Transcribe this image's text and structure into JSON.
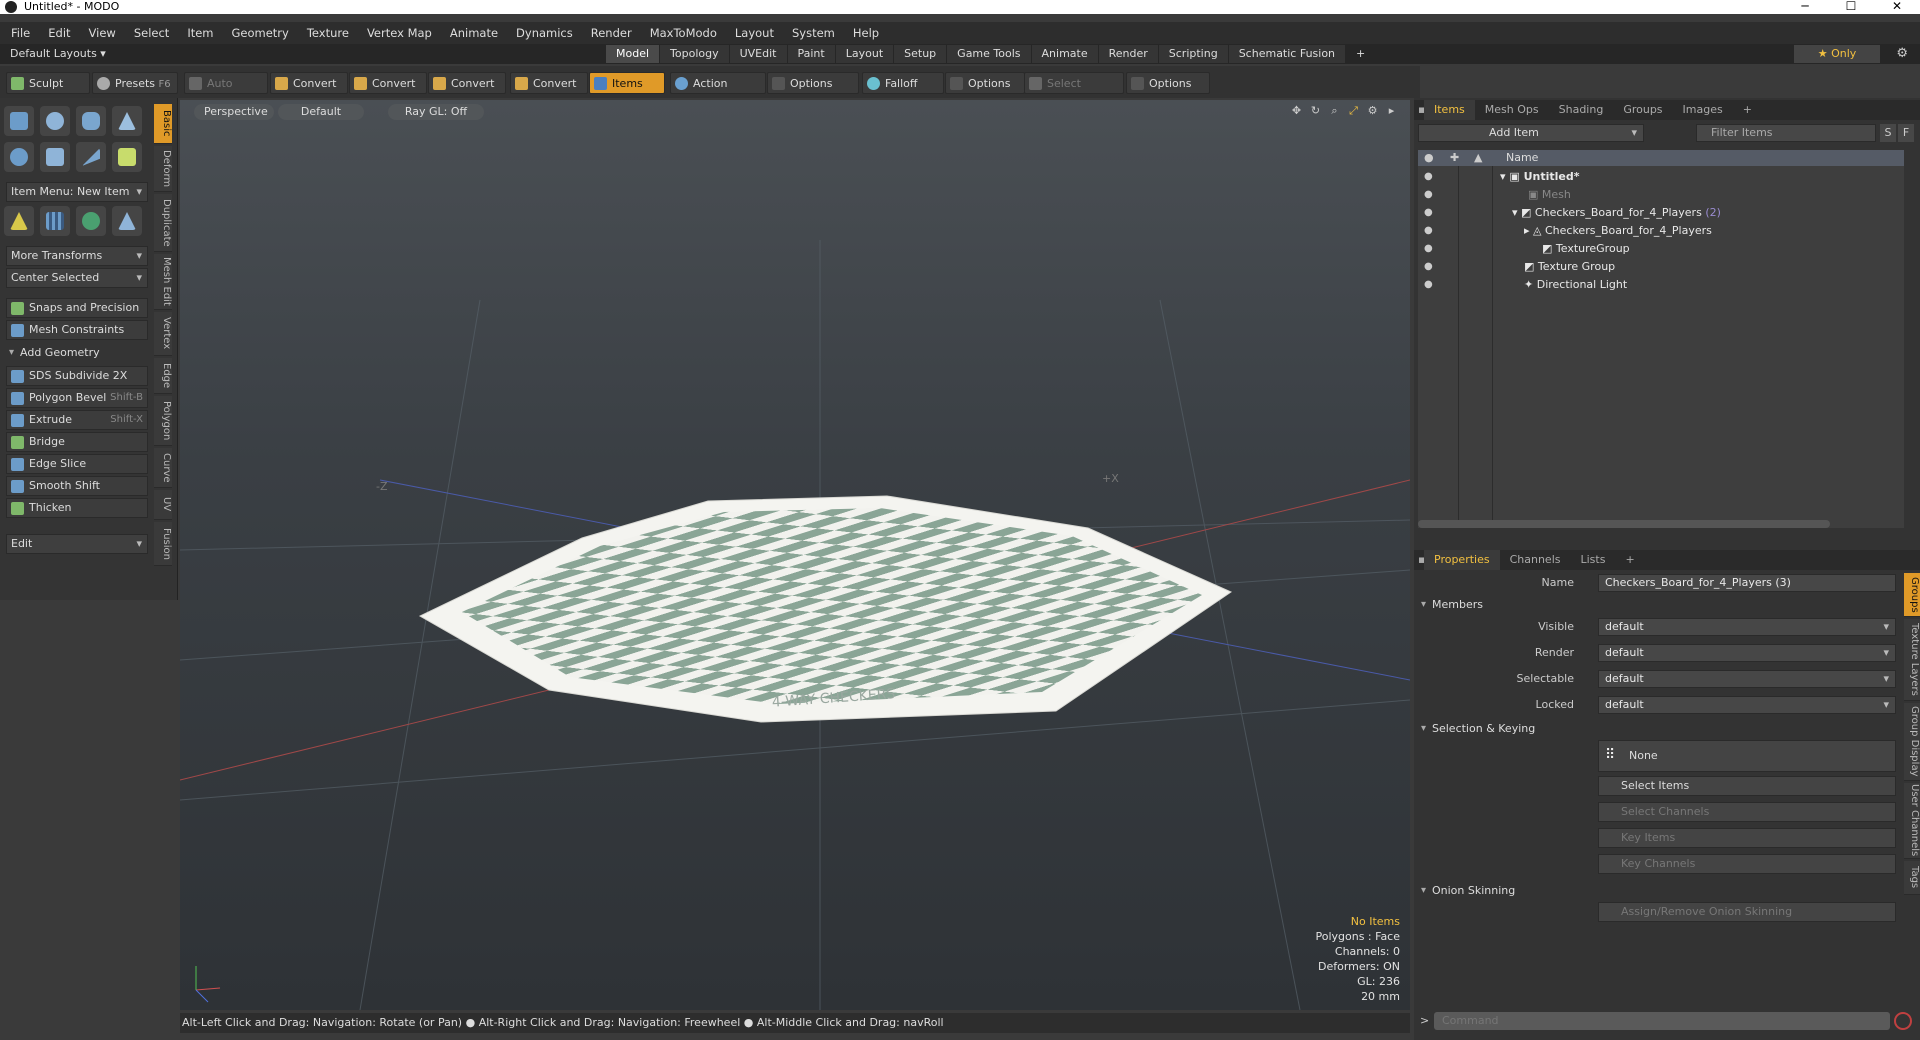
{
  "window": {
    "title": "Untitled* - MODO",
    "min": "─",
    "max": "☐",
    "close": "✕"
  },
  "menu": [
    "File",
    "Edit",
    "View",
    "Select",
    "Item",
    "Geometry",
    "Texture",
    "Vertex Map",
    "Animate",
    "Dynamics",
    "Render",
    "MaxToModo",
    "Layout",
    "System",
    "Help"
  ],
  "layoutbar": {
    "default_layouts": "Default Layouts ▾",
    "tabs": [
      "Model",
      "Topology",
      "UVEdit",
      "Paint",
      "Layout",
      "Setup",
      "Game Tools",
      "Animate",
      "Render",
      "Scripting",
      "Schematic Fusion"
    ],
    "plus": "+",
    "only": "★ Only"
  },
  "toolbar": {
    "sculpt": "Sculpt",
    "presets": "Presets",
    "presets_sc": "F6",
    "auto_select": "Auto Select",
    "convert": "Convert",
    "items": "Items",
    "action_center": "Action Center",
    "options": "Options",
    "falloff": "Falloff",
    "select_through": "Select Through"
  },
  "leftpanel": {
    "item_menu": "Item Menu: New Item",
    "more_transforms": "More Transforms",
    "center_selected": "Center Selected",
    "snaps": "Snaps and Precision",
    "mesh_constraints": "Mesh Constraints",
    "add_geometry": "Add Geometry",
    "tools": [
      {
        "label": "SDS Subdivide 2X",
        "sc": ""
      },
      {
        "label": "Polygon Bevel",
        "sc": "Shift-B"
      },
      {
        "label": "Extrude",
        "sc": "Shift-X"
      },
      {
        "label": "Bridge",
        "sc": ""
      },
      {
        "label": "Edge Slice",
        "sc": ""
      },
      {
        "label": "Smooth Shift",
        "sc": ""
      },
      {
        "label": "Thicken",
        "sc": ""
      }
    ],
    "edit": "Edit",
    "vtabs": [
      "Basic",
      "Deform",
      "Duplicate",
      "Mesh Edit",
      "Vertex",
      "Edge",
      "Polygon",
      "Curve",
      "UV",
      "Fusion"
    ]
  },
  "viewport": {
    "perspective": "Perspective",
    "default": "Default",
    "raygl": "Ray GL: Off",
    "axis_z": "-Z",
    "axis_x": "+X",
    "board_text": "4-WAY CHECKERS",
    "stats": {
      "no_items": "No Items",
      "polygons": "Polygons : Face",
      "channels": "Channels: 0",
      "deformers": "Deformers: ON",
      "gl": "GL: 236",
      "size": "20 mm"
    }
  },
  "statusbar": "Alt-Left Click and Drag: Navigation: Rotate (or Pan) ● Alt-Right Click and Drag: Navigation: Freewheel ● Alt-Middle Click and Drag: navRoll",
  "items_panel": {
    "tabs": [
      "Items",
      "Mesh Ops",
      "Shading",
      "Groups",
      "Images",
      "+"
    ],
    "add_item": "Add Item",
    "filter_items": "Filter Items",
    "s": "S",
    "f": "F",
    "name_col": "Name",
    "tree": [
      {
        "label": "Untitled*",
        "count": "",
        "indent": 0
      },
      {
        "label": "Mesh",
        "count": "",
        "indent": 1
      },
      {
        "label": "Checkers_Board_for_4_Players",
        "count": "(2)",
        "indent": 1
      },
      {
        "label": "Checkers_Board_for_4_Players",
        "count": "",
        "indent": 2
      },
      {
        "label": "TextureGroup",
        "count": "",
        "indent": 2
      },
      {
        "label": "Texture Group",
        "count": "",
        "indent": 1
      },
      {
        "label": "Directional Light",
        "count": "",
        "indent": 1
      }
    ]
  },
  "properties": {
    "tabs": [
      "Properties",
      "Channels",
      "Lists",
      "+"
    ],
    "name_label": "Name",
    "name_value": "Checkers_Board_for_4_Players (3)",
    "members": "Members",
    "visible": "Visible",
    "render": "Render",
    "selectable": "Selectable",
    "locked": "Locked",
    "default": "default",
    "selection_keying": "Selection & Keying",
    "none": "None",
    "select_items": "Select Items",
    "select_channels": "Select Channels",
    "key_items": "Key Items",
    "key_channels": "Key Channels",
    "onion": "Onion Skinning",
    "assign_onion": "Assign/Remove Onion Skinning",
    "vtabs": [
      "Groups",
      "Texture Layers",
      "Group Display",
      "User Channels",
      "Tags"
    ]
  },
  "command": {
    "prompt": ">",
    "placeholder": "Command"
  }
}
